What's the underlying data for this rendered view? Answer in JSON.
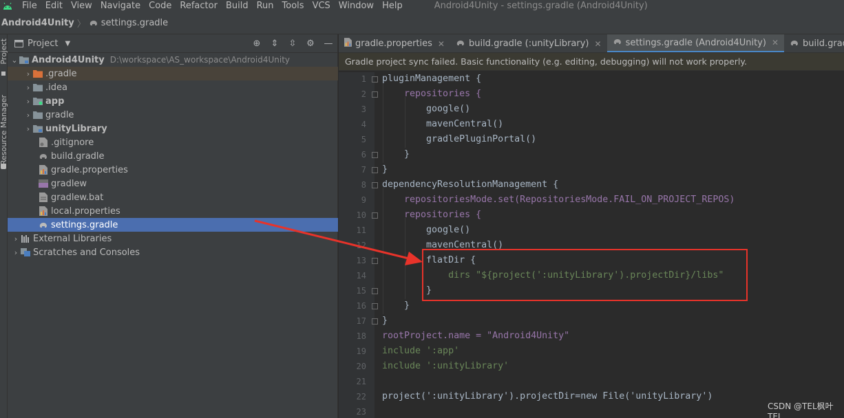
{
  "menu": {
    "items": [
      "File",
      "Edit",
      "View",
      "Navigate",
      "Code",
      "Refactor",
      "Build",
      "Run",
      "Tools",
      "VCS",
      "Window",
      "Help"
    ],
    "window_title": "Android4Unity - settings.gradle (Android4Unity)"
  },
  "breadcrumb": {
    "project": "Android4Unity",
    "file": "settings.gradle"
  },
  "toolstrip": {
    "project_label": "Project",
    "resource_label": "Resource Manager"
  },
  "panel": {
    "title": "Project",
    "tree": [
      {
        "label": "Android4Unity",
        "path": "D:\\workspace\\AS_workspace\\Android4Unity",
        "bold": true
      },
      {
        "label": ".gradle"
      },
      {
        "label": ".idea"
      },
      {
        "label": "app",
        "bold": true
      },
      {
        "label": "gradle"
      },
      {
        "label": "unityLibrary",
        "bold": true
      },
      {
        "label": ".gitignore"
      },
      {
        "label": "build.gradle"
      },
      {
        "label": "gradle.properties"
      },
      {
        "label": "gradlew"
      },
      {
        "label": "gradlew.bat"
      },
      {
        "label": "local.properties"
      },
      {
        "label": "settings.gradle"
      },
      {
        "label": "External Libraries"
      },
      {
        "label": "Scratches and Consoles"
      }
    ]
  },
  "editor": {
    "tabs": [
      {
        "label": "gradle.properties"
      },
      {
        "label": "build.gradle (:unityLibrary)"
      },
      {
        "label": "settings.gradle (Android4Unity)"
      },
      {
        "label": "build.gradle (Android"
      }
    ],
    "banner": "Gradle project sync failed. Basic functionality (e.g. editing, debugging) will not work properly.",
    "line_numbers": [
      "1",
      "2",
      "3",
      "4",
      "5",
      "6",
      "7",
      "8",
      "9",
      "10",
      "11",
      "12",
      "13",
      "14",
      "15",
      "16",
      "17",
      "18",
      "19",
      "20",
      "21",
      "22",
      "23"
    ],
    "code": [
      "pluginManagement {",
      "    repositories {",
      "        google()",
      "        mavenCentral()",
      "        gradlePluginPortal()",
      "    }",
      "}",
      "dependencyResolutionManagement {",
      "    repositoriesMode.set(RepositoriesMode.FAIL_ON_PROJECT_REPOS)",
      "    repositories {",
      "        google()",
      "        mavenCentral()",
      "        flatDir {",
      "            dirs \"${project(':unityLibrary').projectDir}/libs\"",
      "        }",
      "    }",
      "}",
      "rootProject.name = \"Android4Unity\"",
      "include ':app'",
      "include ':unityLibrary'",
      "",
      "project(':unityLibrary').projectDir=new File('unityLibrary')",
      ""
    ]
  },
  "watermark": "CSDN @TEL枫叶TEL",
  "colors": {
    "accent": "#4b6eaf",
    "annotation": "#e8332a",
    "keyword": "#cc7832",
    "string": "#6a8759",
    "field": "#9876aa"
  }
}
